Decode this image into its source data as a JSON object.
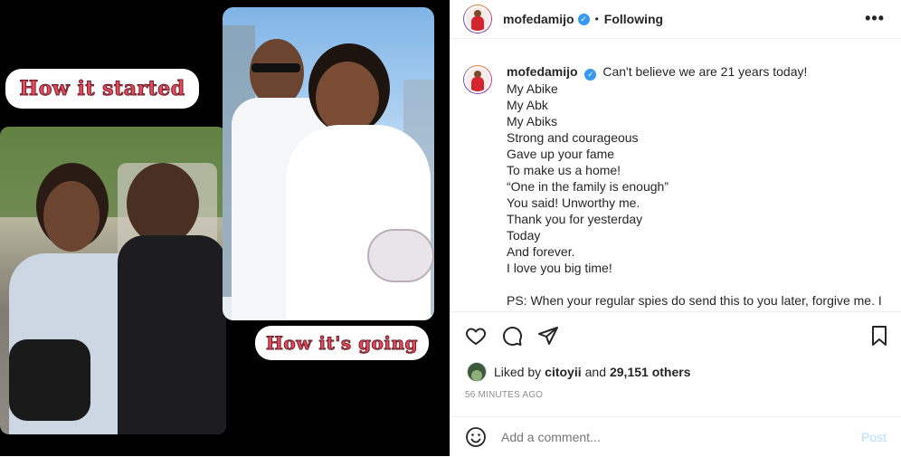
{
  "post": {
    "labels": {
      "top": "How it started",
      "bottom": "How it's going"
    }
  },
  "header": {
    "username": "mofedamijo",
    "separator": "•",
    "follow_state": "Following",
    "more_icon": "more-horizontal-icon"
  },
  "caption": {
    "username": "mofedamijo",
    "first_line": "Can't believe we are 21 years today!",
    "lines": [
      "My Abike",
      "My Abk",
      "My Abiks",
      "Strong and courageous",
      "Gave up your fame",
      "To make us a home!",
      "“One in the family is enough”",
      "You said! Unworthy me.",
      "Thank you for yesterday",
      "Today",
      "And forever.",
      "I love you big time!",
      "",
      "PS: When your regular spies do send this to you later, forgive me. I"
    ]
  },
  "actions": {
    "like_icon": "heart-icon",
    "comment_icon": "comment-icon",
    "share_icon": "share-icon",
    "save_icon": "bookmark-icon"
  },
  "likes": {
    "prefix": "Liked by",
    "user": "citoyii",
    "middle": "and",
    "count": "29,151 others"
  },
  "timestamp": "56 MINUTES AGO",
  "comment_box": {
    "emoji_icon": "emoji-icon",
    "placeholder": "Add a comment...",
    "post_label": "Post"
  },
  "colors": {
    "verified": "#3897f0",
    "post_button": "#b2dffc",
    "label_text": "#e8495b"
  }
}
